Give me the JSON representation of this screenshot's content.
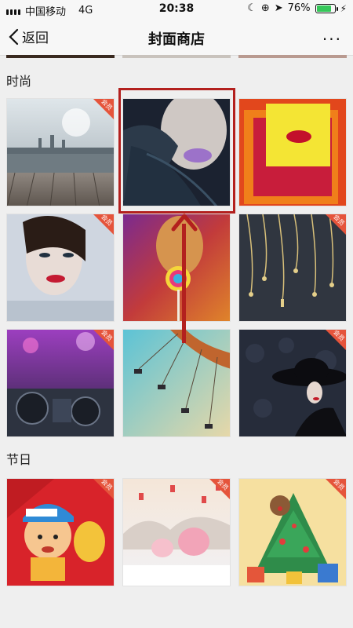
{
  "status": {
    "carrier": "中国移动",
    "network": "4G",
    "time": "20:38",
    "battery": "76%",
    "battery_level": 0.76
  },
  "nav": {
    "back_label": "返回",
    "title": "封面商店",
    "more": "···"
  },
  "sections": [
    {
      "title": "时尚"
    },
    {
      "title": "节日"
    }
  ],
  "badge_label": "会员",
  "colors": {
    "accent": "#e5543b",
    "highlight": "#b3201e"
  }
}
